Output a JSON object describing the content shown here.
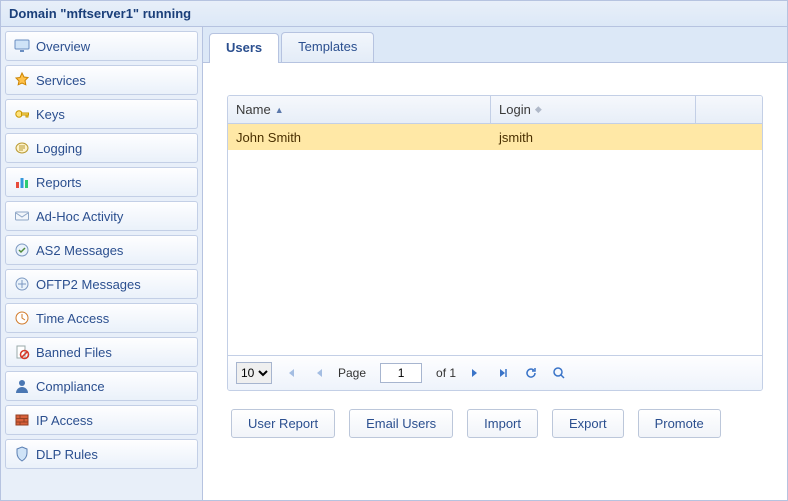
{
  "window": {
    "title": "Domain \"mftserver1\" running"
  },
  "sidebar": {
    "items": [
      {
        "label": "Overview",
        "icon": "monitor-icon"
      },
      {
        "label": "Services",
        "icon": "services-icon"
      },
      {
        "label": "Keys",
        "icon": "key-icon"
      },
      {
        "label": "Logging",
        "icon": "log-icon"
      },
      {
        "label": "Reports",
        "icon": "chart-icon"
      },
      {
        "label": "Ad-Hoc Activity",
        "icon": "mail-activity-icon"
      },
      {
        "label": "AS2 Messages",
        "icon": "as2-icon"
      },
      {
        "label": "OFTP2 Messages",
        "icon": "oftp2-icon"
      },
      {
        "label": "Time Access",
        "icon": "clock-icon"
      },
      {
        "label": "Banned Files",
        "icon": "banned-icon"
      },
      {
        "label": "Compliance",
        "icon": "person-icon"
      },
      {
        "label": "IP Access",
        "icon": "firewall-icon"
      },
      {
        "label": "DLP Rules",
        "icon": "shield-icon"
      }
    ]
  },
  "tabs": {
    "users": {
      "label": "Users",
      "active": true
    },
    "templates": {
      "label": "Templates",
      "active": false
    }
  },
  "grid": {
    "columns": {
      "name": "Name",
      "login": "Login"
    },
    "sort": {
      "column": "name",
      "direction": "asc"
    },
    "rows": [
      {
        "name": "John Smith",
        "login": "jsmith",
        "selected": true
      }
    ]
  },
  "pager": {
    "pageSize": "10",
    "pageLabel": "Page",
    "page": "1",
    "ofLabel": "of 1"
  },
  "buttons": {
    "userReport": "User Report",
    "emailUsers": "Email Users",
    "import": "Import",
    "export": "Export",
    "promote": "Promote"
  }
}
